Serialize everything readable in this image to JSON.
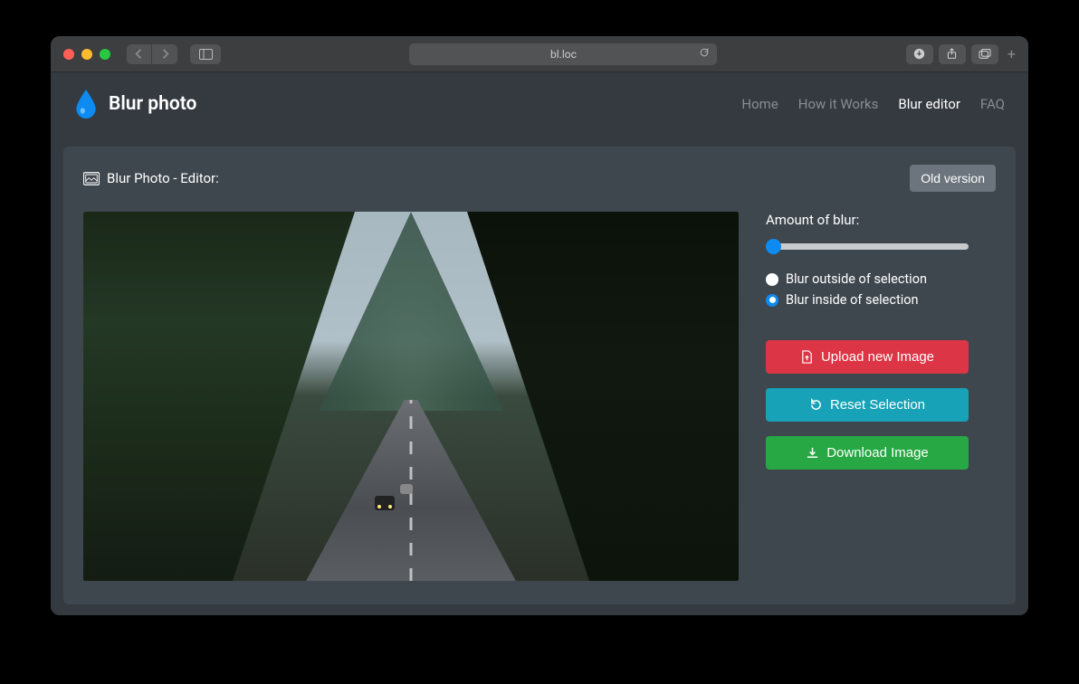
{
  "browser": {
    "url": "bl.loc"
  },
  "header": {
    "brand": "Blur photo",
    "nav": [
      "Home",
      "How it Works",
      "Blur editor",
      "FAQ"
    ],
    "active_index": 2
  },
  "panel": {
    "title": "Blur Photo - Editor:",
    "old_version_label": "Old version"
  },
  "sidebar": {
    "amount_label": "Amount of blur:",
    "slider_value": 0,
    "radio_outside": "Blur outside of selection",
    "radio_inside": "Blur inside of selection",
    "selected_radio": "inside",
    "upload_label": "Upload new Image",
    "reset_label": "Reset Selection",
    "download_label": "Download Image"
  }
}
